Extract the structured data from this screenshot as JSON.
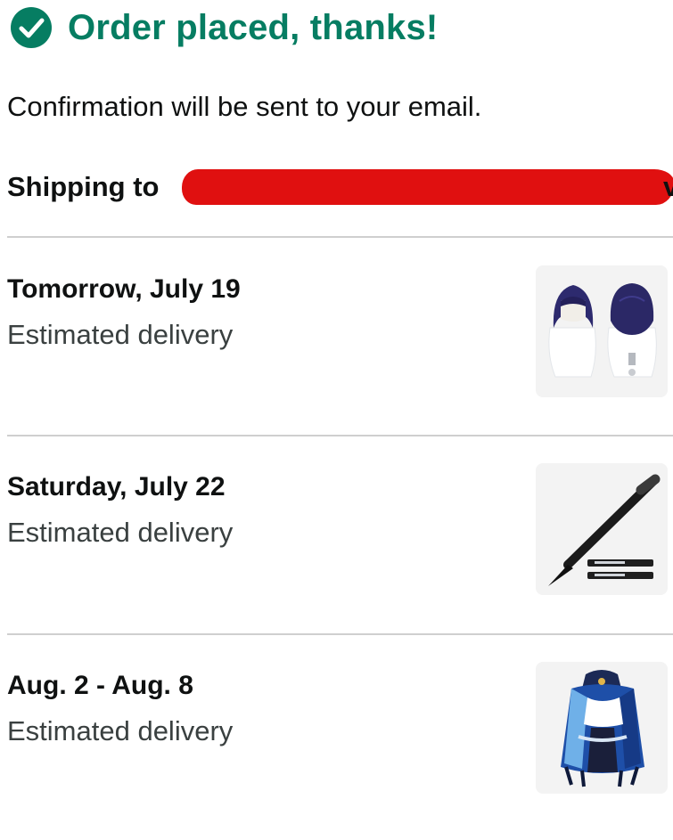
{
  "header": {
    "title": "Order placed, thanks!",
    "icon": "check-circle-icon",
    "accent_color": "#067d62"
  },
  "confirmation_text": "Confirmation will be sent to your email.",
  "shipping": {
    "label": "Shipping to",
    "tail_visible": "v",
    "address_redacted": true,
    "redaction_color": "#e01010"
  },
  "deliveries": [
    {
      "date": "Tomorrow, July 19",
      "label": "Estimated delivery",
      "item_icon": "purple-wig-product-image"
    },
    {
      "date": "Saturday, July 22",
      "label": "Estimated delivery",
      "item_icon": "black-brush-pen-product-image"
    },
    {
      "date": "Aug. 2 - Aug. 8",
      "label": "Estimated delivery",
      "item_icon": "blue-costume-product-image"
    }
  ]
}
